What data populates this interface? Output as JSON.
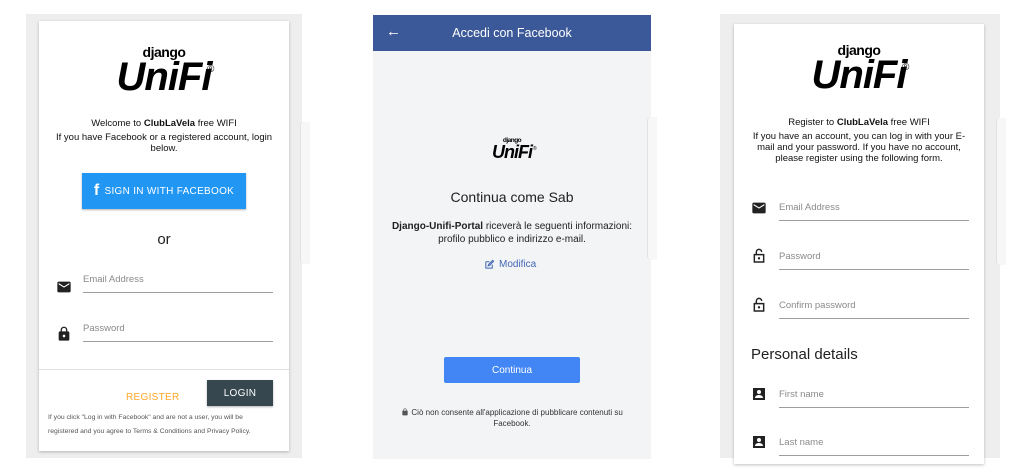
{
  "screen1": {
    "logo": {
      "top": "django",
      "main": "UniFi",
      "mark": "®"
    },
    "welcome_prefix": "Welcome to ",
    "welcome_brand": "ClubLaVela",
    "welcome_suffix": " free WIFI",
    "intro_line1": "If you have Facebook or a registered account, login",
    "intro_line2": "below.",
    "facebook_button": "SIGN IN WITH FACEBOOK",
    "or_label": "or",
    "email_placeholder": "Email Address",
    "password_placeholder": "Password",
    "register_button": "REGISTER",
    "login_button": "LOGIN",
    "footer_line1": "If you click \"Log in with Facebook\" and are not a user, you will be",
    "footer_line2": "registered and you agree to Terms & Conditions and Privacy Policy."
  },
  "screen2": {
    "header_title": "Accedi con Facebook",
    "back_icon": "arrow-left-icon",
    "logo": {
      "top": "django",
      "main": "UniFi",
      "mark": "®"
    },
    "continue_as": "Continua come Sab",
    "app_name": "Django-Unifi-Portal",
    "info_line1_rest": " riceverà le seguenti informazioni:",
    "info_line2": "profilo pubblico e indirizzo e-mail.",
    "edit_link": "Modifica",
    "continue_button": "Continua",
    "privacy_line1": "Ciò non consente all'applicazione di pubblicare contenuti su",
    "privacy_line2": "Facebook."
  },
  "screen3": {
    "logo": {
      "top": "django",
      "main": "UniFi",
      "mark": "®"
    },
    "register_prefix": "Register to ",
    "register_brand": "ClubLaVela",
    "register_suffix": " free WIFI",
    "intro_line1": "If you have an account, you can log in with your E-",
    "intro_line2": "mail and your password. If you have no account,",
    "intro_line3": "please register using the following form.",
    "email_placeholder": "Email Address",
    "password_placeholder": "Password",
    "confirm_placeholder": "Confirm password",
    "section_title": "Personal details",
    "first_name_placeholder": "First name",
    "last_name_placeholder": "Last name"
  },
  "colors": {
    "facebook_button": "#2196f3",
    "facebook_header": "#3b5998",
    "register_text": "#ffa726",
    "login_button": "#37474f",
    "continue_button": "#4285f4"
  }
}
